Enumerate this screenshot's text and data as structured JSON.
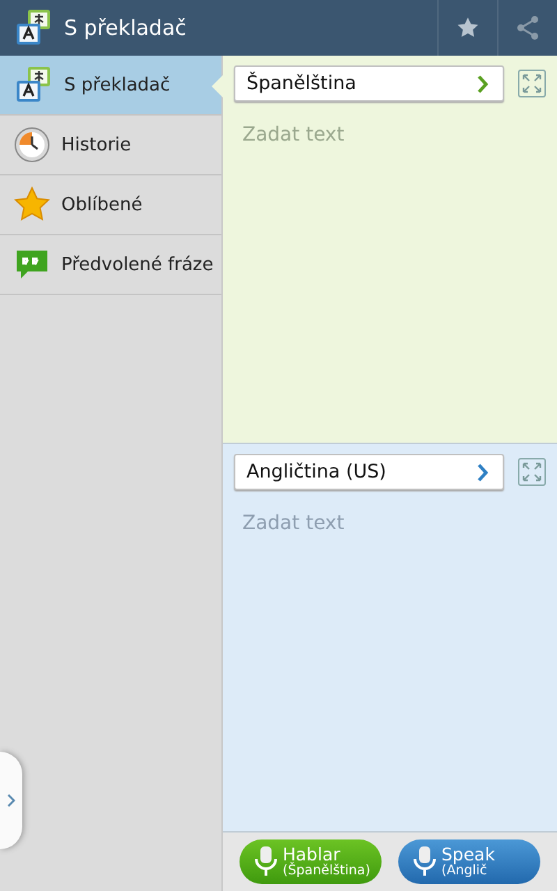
{
  "app_bar": {
    "title": "S překladač"
  },
  "sidebar": {
    "items": [
      {
        "label": "S překladač",
        "kind": "translator",
        "selected": true
      },
      {
        "label": "Historie",
        "kind": "history",
        "selected": false
      },
      {
        "label": "Oblíbené",
        "kind": "favorites",
        "selected": false
      },
      {
        "label": "Předvolené fráze",
        "kind": "phrases",
        "selected": false
      }
    ]
  },
  "panes": [
    {
      "kind": "source",
      "language": "Španělština",
      "placeholder": "Zadat text"
    },
    {
      "kind": "target",
      "language": "Angličtina (US)",
      "placeholder": "Zadat text"
    }
  ],
  "voice_buttons": [
    {
      "kind": "source",
      "label": "Hablar",
      "sublabel": "(Španělština)"
    },
    {
      "kind": "target",
      "label": "Speak",
      "sublabel": "(Anglič"
    }
  ]
}
